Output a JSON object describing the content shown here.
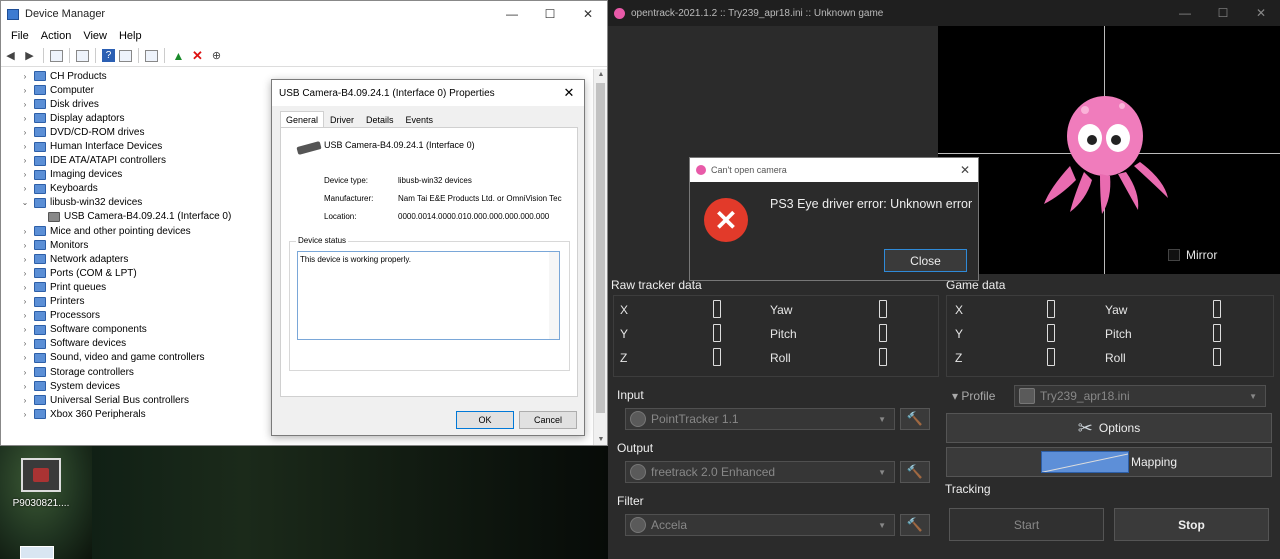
{
  "device_manager": {
    "title": "Device Manager",
    "controls": {
      "minimize": "—",
      "maximize": "☐",
      "close": "✕"
    },
    "menu": [
      "File",
      "Action",
      "View",
      "Help"
    ],
    "tree": [
      {
        "label": "CH Products",
        "expanded": false
      },
      {
        "label": "Computer",
        "expanded": false
      },
      {
        "label": "Disk drives",
        "expanded": false
      },
      {
        "label": "Display adaptors",
        "expanded": false
      },
      {
        "label": "DVD/CD-ROM drives",
        "expanded": false
      },
      {
        "label": "Human Interface Devices",
        "expanded": false
      },
      {
        "label": "IDE ATA/ATAPI controllers",
        "expanded": false
      },
      {
        "label": "Imaging devices",
        "expanded": false
      },
      {
        "label": "Keyboards",
        "expanded": false
      },
      {
        "label": "libusb-win32 devices",
        "expanded": true
      },
      {
        "label": "USB Camera-B4.09.24.1 (Interface 0)",
        "child": true
      },
      {
        "label": "Mice and other pointing devices",
        "expanded": false
      },
      {
        "label": "Monitors",
        "expanded": false
      },
      {
        "label": "Network adapters",
        "expanded": false
      },
      {
        "label": "Ports (COM & LPT)",
        "expanded": false
      },
      {
        "label": "Print queues",
        "expanded": false
      },
      {
        "label": "Printers",
        "expanded": false
      },
      {
        "label": "Processors",
        "expanded": false
      },
      {
        "label": "Software components",
        "expanded": false
      },
      {
        "label": "Software devices",
        "expanded": false
      },
      {
        "label": "Sound, video and game controllers",
        "expanded": false
      },
      {
        "label": "Storage controllers",
        "expanded": false
      },
      {
        "label": "System devices",
        "expanded": false
      },
      {
        "label": "Universal Serial Bus controllers",
        "expanded": false
      },
      {
        "label": "Xbox 360 Peripherals",
        "expanded": false
      }
    ]
  },
  "properties": {
    "title": "USB Camera-B4.09.24.1 (Interface 0) Properties",
    "close": "✕",
    "tabs": [
      "General",
      "Driver",
      "Details",
      "Events"
    ],
    "device_name": "USB Camera-B4.09.24.1 (Interface 0)",
    "device_type_label": "Device type:",
    "device_type": "libusb-win32 devices",
    "manufacturer_label": "Manufacturer:",
    "manufacturer": "Nam Tai E&E Products Ltd. or OmniVision Tec",
    "location_label": "Location:",
    "location": "0000.0014.0000.010.000.000.000.000.000",
    "status_legend": "Device status",
    "status_text": "This device is working properly.",
    "ok": "OK",
    "cancel": "Cancel"
  },
  "desktop": {
    "icon_label": "P9030821...."
  },
  "opentrack": {
    "title": "opentrack-2021.1.2 :: Try239_apr18.ini :: Unknown game",
    "controls": {
      "minimize": "—",
      "maximize": "☐",
      "close": "✕"
    },
    "mirror": "Mirror",
    "raw_tracker_label": "Raw tracker data",
    "game_data_label": "Game data",
    "axes_left": [
      "X",
      "Y",
      "Z"
    ],
    "axes_right": [
      "Yaw",
      "Pitch",
      "Roll"
    ],
    "input_label": "Input",
    "input_value": "PointTracker 1.1",
    "output_label": "Output",
    "output_value": "freetrack 2.0 Enhanced",
    "filter_label": "Filter",
    "filter_value": "Accela",
    "profile_label": "Profile",
    "profile_value": "Try239_apr18.ini",
    "options": "Options",
    "mapping": "Mapping",
    "tracking_label": "Tracking",
    "start": "Start",
    "stop": "Stop"
  },
  "error_dialog": {
    "title": "Can't open camera",
    "close": "✕",
    "message": "PS3 Eye driver error: Unknown error",
    "button": "Close",
    "icon": "error-x-icon",
    "icon_color": "#e23a2a"
  }
}
